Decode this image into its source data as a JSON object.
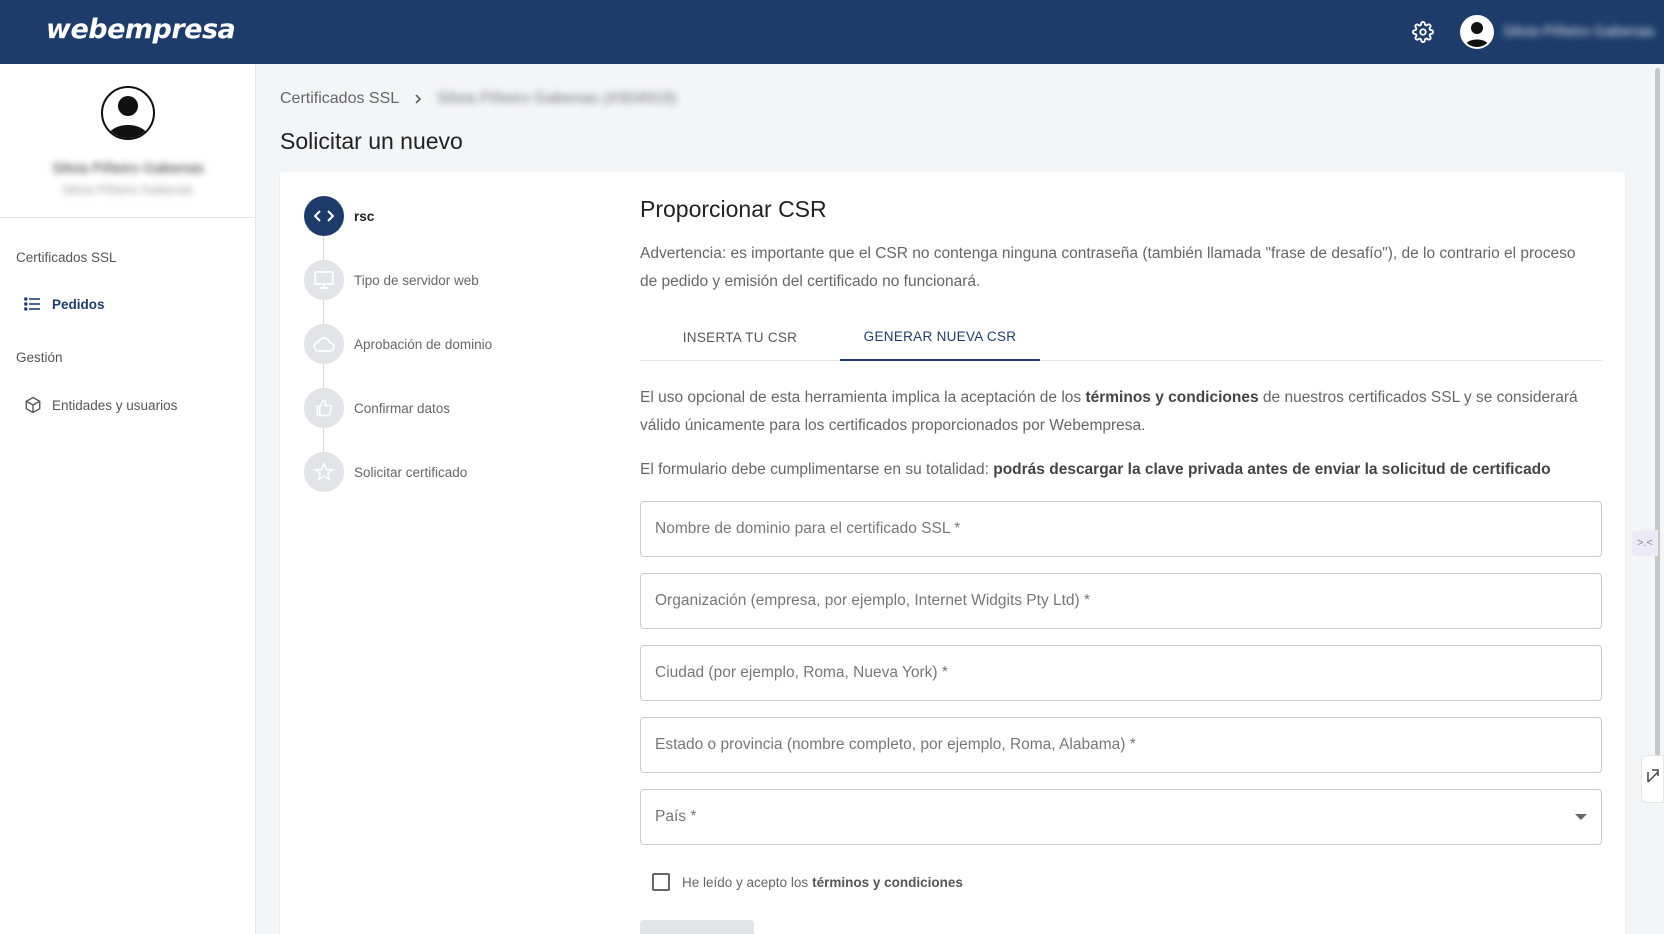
{
  "app": {
    "logo": "webempresa",
    "settings_icon": "gear-icon",
    "username": "Silvia Piñeiro Gabenas"
  },
  "sidebar": {
    "profile_name": "Silvia Piñeiro Gabenas",
    "profile_sub": "Silvia Piñeiro Gabenas",
    "sections": [
      {
        "title": "Certificados SSL",
        "items": [
          {
            "label": "Pedidos",
            "icon": "list-icon"
          }
        ]
      },
      {
        "title": "Gestión",
        "items": [
          {
            "label": "Entidades y usuarios",
            "icon": "cube-icon"
          }
        ]
      }
    ]
  },
  "breadcrumb": {
    "root": "Certificados SSL",
    "current": "Silvia Piñeiro Gabenas (#304919)"
  },
  "page_title": "Solicitar un nuevo",
  "stepper": [
    {
      "label": "rsc",
      "icon": "code-icon",
      "active": true
    },
    {
      "label": "Tipo de servidor web",
      "icon": "monitor-icon",
      "active": false
    },
    {
      "label": "Aprobación de dominio",
      "icon": "cloud-icon",
      "active": false
    },
    {
      "label": "Confirmar datos",
      "icon": "thumbs-up-icon",
      "active": false
    },
    {
      "label": "Solicitar certificado",
      "icon": "star-icon",
      "active": false
    }
  ],
  "content": {
    "title": "Proporcionar CSR",
    "warning": "Advertencia: es importante que el CSR no contenga ninguna contraseña (también llamada \"frase de desafío\"), de lo contrario el proceso de pedido y emisión del certificado no funcionará.",
    "tabs": [
      {
        "label": "INSERTA TU CSR",
        "active": false
      },
      {
        "label": "GENERAR NUEVA CSR",
        "active": true
      }
    ],
    "para1_prefix": "El uso opcional de esta herramienta implica la aceptación de los ",
    "para1_bold": "términos y condiciones",
    "para1_suffix": " de nuestros certificados SSL y se considerará válido únicamente para los certificados proporcionados por Webempresa.",
    "para2_prefix": "El formulario debe cumplimentarse en su totalidad: ",
    "para2_bold": "podrás descargar la clave privada antes de enviar la solicitud de certificado",
    "fields": {
      "domain": "Nombre de dominio para el certificado SSL *",
      "organization": "Organización (empresa, por ejemplo, Internet Widgits Pty Ltd) *",
      "city": "Ciudad (por ejemplo, Roma, Nueva York) *",
      "state": "Estado o provincia (nombre completo, por ejemplo, Roma, Alabama) *",
      "country": "País *"
    },
    "terms_prefix": "He leído y acepto los",
    "terms_bold": "términos y condiciones"
  },
  "edge_widget_label": ">.<"
}
